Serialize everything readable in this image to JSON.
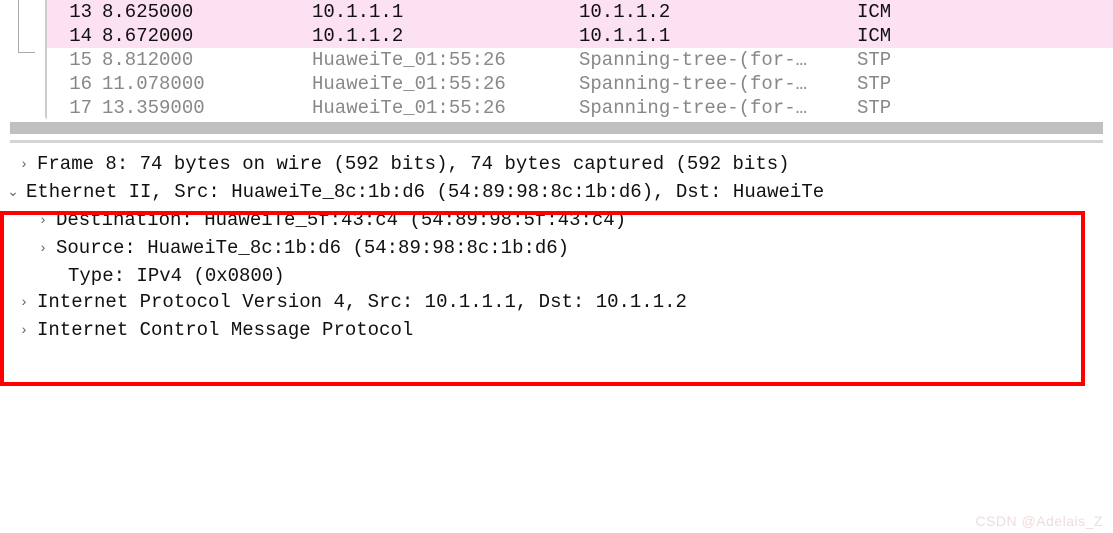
{
  "packet_list": [
    {
      "no": "13",
      "time": "8.625000",
      "source": "10.1.1.1",
      "dest": "10.1.1.2",
      "proto": "ICM",
      "highlighted": true
    },
    {
      "no": "14",
      "time": "8.672000",
      "source": "10.1.1.2",
      "dest": "10.1.1.1",
      "proto": "ICM",
      "highlighted": true
    },
    {
      "no": "15",
      "time": "8.812000",
      "source": "HuaweiTe_01:55:26",
      "dest": "Spanning-tree-(for-…",
      "proto": "STP",
      "highlighted": false
    },
    {
      "no": "16",
      "time": "11.078000",
      "source": "HuaweiTe_01:55:26",
      "dest": "Spanning-tree-(for-…",
      "proto": "STP",
      "highlighted": false
    },
    {
      "no": "17",
      "time": "13.359000",
      "source": "HuaweiTe_01:55:26",
      "dest": "Spanning-tree-(for-…",
      "proto": "STP",
      "highlighted": false
    }
  ],
  "details": {
    "frame": "Frame 8: 74 bytes on wire (592 bits), 74 bytes captured (592 bits)",
    "ethernet": "Ethernet II, Src: HuaweiTe_8c:1b:d6 (54:89:98:8c:1b:d6), Dst: HuaweiTe",
    "eth_dest": "Destination: HuaweiTe_5f:43:c4 (54:89:98:5f:43:c4)",
    "eth_src": "Source: HuaweiTe_8c:1b:d6 (54:89:98:8c:1b:d6)",
    "eth_type": "Type: IPv4 (0x0800)",
    "ipv4": "Internet Protocol Version 4, Src: 10.1.1.1, Dst: 10.1.1.2",
    "icmp": "Internet Control Message Protocol"
  },
  "watermark": "CSDN @Adelais_Z"
}
